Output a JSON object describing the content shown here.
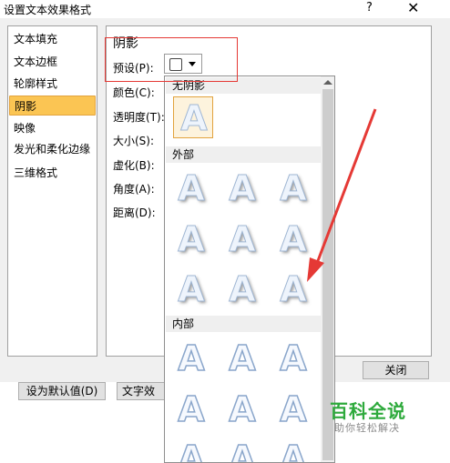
{
  "window": {
    "title": "设置文本效果格式",
    "help_label": "?",
    "close_label": "✕"
  },
  "sidebar": {
    "items": [
      {
        "label": "文本填充"
      },
      {
        "label": "文本边框"
      },
      {
        "label": "轮廓样式"
      },
      {
        "label": "阴影",
        "selected": true
      },
      {
        "label": "映像"
      },
      {
        "label": "发光和柔化边缘"
      },
      {
        "label": "三维格式"
      }
    ]
  },
  "panel": {
    "title": "阴影",
    "preset_label": "预设(P):",
    "fields": [
      {
        "label": "颜色(C):"
      },
      {
        "label": "透明度(T):"
      },
      {
        "label": "大小(S):"
      },
      {
        "label": "虚化(B):"
      },
      {
        "label": "角度(A):"
      },
      {
        "label": "距离(D):"
      }
    ]
  },
  "preset_dropdown": {
    "sections": [
      {
        "label": "无阴影"
      },
      {
        "label": "外部"
      },
      {
        "label": "内部"
      }
    ],
    "tile_glyph": "A"
  },
  "buttons": {
    "close": "关闭",
    "reset": "设为默认值(D)",
    "text_effects": "文字效果"
  },
  "watermark": {
    "main": "百科全说",
    "sub": "助你轻松解决"
  },
  "colors": {
    "selection": "#fbc553",
    "annotation": "#e53935"
  }
}
